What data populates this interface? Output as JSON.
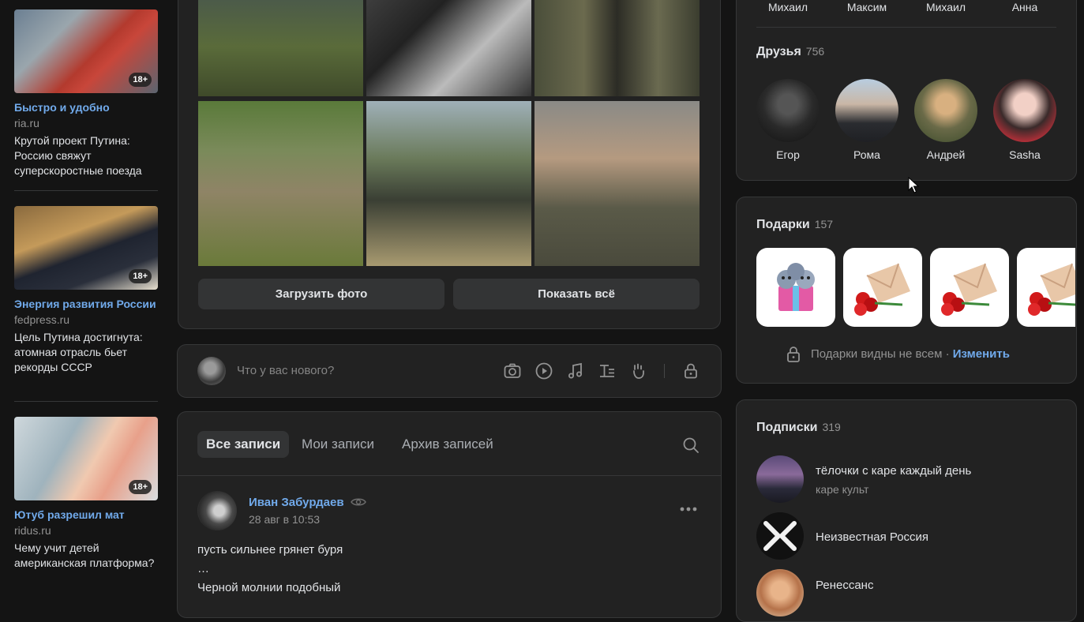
{
  "news": [
    {
      "title": "Быстро и удобно",
      "source": "ria.ru",
      "text": "Крутой проект Путина: Россию свяжут суперскоростные поезда",
      "age": "18+"
    },
    {
      "title": "Энергия развития России",
      "source": "fedpress.ru",
      "text": "Цель Путина достигнута: атомная отрасль бьет рекорды СССР",
      "age": "18+"
    },
    {
      "title": "Ютуб разрешил мат",
      "source": "ridus.ru",
      "text": "Чему учит детей американская платформа?",
      "age": "18+"
    }
  ],
  "photos": {
    "upload_label": "Загрузить фото",
    "show_all_label": "Показать всё"
  },
  "composer": {
    "placeholder": "Что у вас нового?",
    "tools": [
      "camera-icon",
      "video-icon",
      "music-icon",
      "article-icon",
      "clip-icon",
      "lock-icon"
    ]
  },
  "wall": {
    "tabs": [
      "Все записи",
      "Мои записи",
      "Архив записей"
    ],
    "active_tab": "Все записи",
    "post": {
      "author": "Иван Забурдаев",
      "date": "28 авг в 10:53",
      "lines": [
        "пусть сильнее грянет буря",
        "…",
        "Черной молнии подобный"
      ]
    }
  },
  "friends": {
    "top_names": [
      "Михаил",
      "Максим",
      "Михаил",
      "Анна"
    ],
    "title": "Друзья",
    "count": "756",
    "items": [
      "Егор",
      "Рома",
      "Андрей",
      "Sasha"
    ]
  },
  "gifts": {
    "title": "Подарки",
    "count": "157",
    "note": "Подарки видны не всем ·",
    "change_label": "Изменить"
  },
  "subscriptions": {
    "title": "Подписки",
    "count": "319",
    "items": [
      {
        "name": "тёлочки с каре каждый день",
        "desc": "каре культ"
      },
      {
        "name": "Неизвестная Россия",
        "desc": ""
      },
      {
        "name": "Ренессанс",
        "desc": ""
      }
    ]
  },
  "colors": {
    "accent": "#71aaeb",
    "card": "#222222",
    "background": "#141414"
  }
}
